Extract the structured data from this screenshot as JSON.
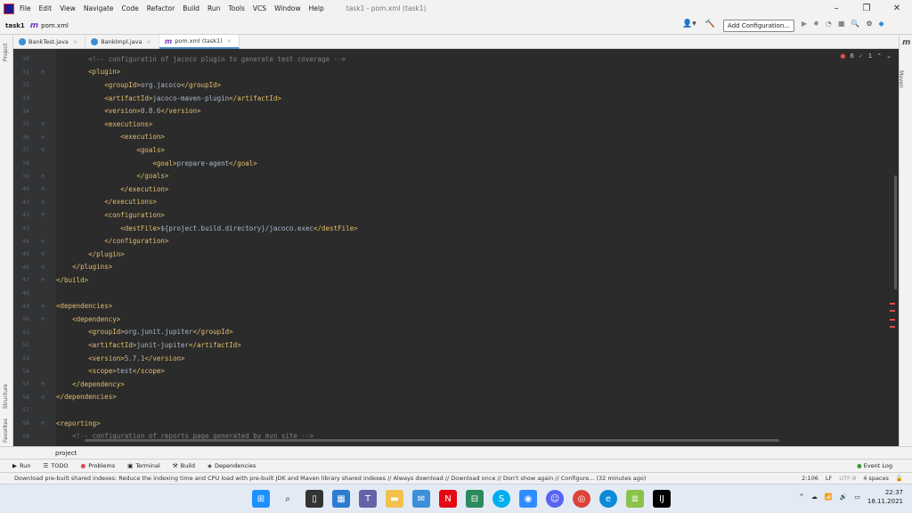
{
  "menubar": {
    "items": [
      "File",
      "Edit",
      "View",
      "Navigate",
      "Code",
      "Refactor",
      "Build",
      "Run",
      "Tools",
      "VCS",
      "Window",
      "Help"
    ],
    "title": "task1 - pom.xml (task1)"
  },
  "navbar": {
    "project": "task1",
    "file": "pom.xml",
    "add_config": "Add Configuration..."
  },
  "tabs": [
    {
      "label": "BankTest.java",
      "type": "class"
    },
    {
      "label": "BankImpl.java",
      "type": "class"
    },
    {
      "label": "pom.xml (task1)",
      "type": "maven"
    }
  ],
  "left_labels": {
    "project": "Project",
    "structure": "Structure",
    "favorites": "Favorites"
  },
  "right_label": "Maven",
  "inspection": {
    "warnings": "6",
    "weak": "1"
  },
  "editor": {
    "lines": [
      {
        "n": "30",
        "indent": "        ",
        "text": "<!-- configuratin of jacoco plugin to generate test coverage -->",
        "kind": "cmt"
      },
      {
        "n": "31",
        "indent": "        ",
        "text": "<plugin>",
        "kind": "tag"
      },
      {
        "n": "32",
        "indent": "            ",
        "pre": "<groupId>",
        "val": "org.jacoco",
        "post": "</groupId>",
        "kind": "mixed"
      },
      {
        "n": "33",
        "indent": "            ",
        "pre": "<artifactId>",
        "val": "jacoco-maven-plugin",
        "post": "</artifactId>",
        "kind": "mixed"
      },
      {
        "n": "34",
        "indent": "            ",
        "pre": "<version>",
        "val": "0.8.6",
        "post": "</version>",
        "kind": "mixed"
      },
      {
        "n": "35",
        "indent": "            ",
        "text": "<executions>",
        "kind": "tag"
      },
      {
        "n": "36",
        "indent": "                ",
        "text": "<execution>",
        "kind": "tag"
      },
      {
        "n": "37",
        "indent": "                    ",
        "text": "<goals>",
        "kind": "tag"
      },
      {
        "n": "38",
        "indent": "                        ",
        "pre": "<goal>",
        "val": "prepare-agent",
        "post": "</goal>",
        "kind": "mixed"
      },
      {
        "n": "39",
        "indent": "                    ",
        "text": "</goals>",
        "kind": "tag"
      },
      {
        "n": "40",
        "indent": "                ",
        "text": "</execution>",
        "kind": "tag"
      },
      {
        "n": "41",
        "indent": "            ",
        "text": "</executions>",
        "kind": "tag"
      },
      {
        "n": "42",
        "indent": "            ",
        "text": "<configuration>",
        "kind": "tag"
      },
      {
        "n": "43",
        "indent": "                ",
        "pre": "<destFile>",
        "val": "${project.build.directory}/jacoco.exec",
        "post": "</destFile>",
        "kind": "mixed"
      },
      {
        "n": "44",
        "indent": "            ",
        "text": "</configuration>",
        "kind": "tag"
      },
      {
        "n": "45",
        "indent": "        ",
        "text": "</plugin>",
        "kind": "tag"
      },
      {
        "n": "46",
        "indent": "    ",
        "text": "</plugins>",
        "kind": "tag"
      },
      {
        "n": "47",
        "indent": "",
        "text": "</build>",
        "kind": "tag"
      },
      {
        "n": "48",
        "indent": "",
        "text": "",
        "kind": "tag"
      },
      {
        "n": "49",
        "indent": "",
        "text": "<dependencies>",
        "kind": "tag"
      },
      {
        "n": "50",
        "indent": "    ",
        "text": "<dependency>",
        "kind": "tag"
      },
      {
        "n": "51",
        "indent": "        ",
        "pre": "<groupId>",
        "val": "org.junit.jupiter",
        "post": "</groupId>",
        "kind": "mixed"
      },
      {
        "n": "52",
        "indent": "        ",
        "pre": "<artifactId>",
        "val": "junit-jupiter",
        "post": "</artifactId>",
        "kind": "mixed"
      },
      {
        "n": "53",
        "indent": "        ",
        "pre": "<version>",
        "val": "5.7.1",
        "post": "</version>",
        "kind": "mixed"
      },
      {
        "n": "54",
        "indent": "        ",
        "pre": "<scope>",
        "val": "test",
        "post": "</scope>",
        "kind": "mixed"
      },
      {
        "n": "55",
        "indent": "    ",
        "text": "</dependency>",
        "kind": "tag"
      },
      {
        "n": "56",
        "indent": "",
        "text": "</dependencies>",
        "kind": "tag"
      },
      {
        "n": "57",
        "indent": "",
        "text": "",
        "kind": "tag"
      },
      {
        "n": "58",
        "indent": "",
        "text": "<reporting>",
        "kind": "tag"
      },
      {
        "n": "59",
        "indent": "    ",
        "text": "<!-- configuration of reports page generated by mvn site -->",
        "kind": "cmt"
      }
    ]
  },
  "project_panel": "project",
  "toolwindows": [
    "Run",
    "TODO",
    "Problems",
    "Terminal",
    "Build",
    "Dependencies"
  ],
  "event_log": "Event Log",
  "status": {
    "message": "Download pre-built shared indexes: Reduce the indexing time and CPU load with pre-built JDK and Maven library shared indexes // Always download // Download once // Don't show again // Configure... (32 minutes ago)",
    "position": "2:106",
    "line_sep": "LF",
    "encoding": "UTF-8",
    "indent": "4 spaces"
  },
  "taskbar": {
    "time": "22:37",
    "date": "18.11.2021"
  }
}
